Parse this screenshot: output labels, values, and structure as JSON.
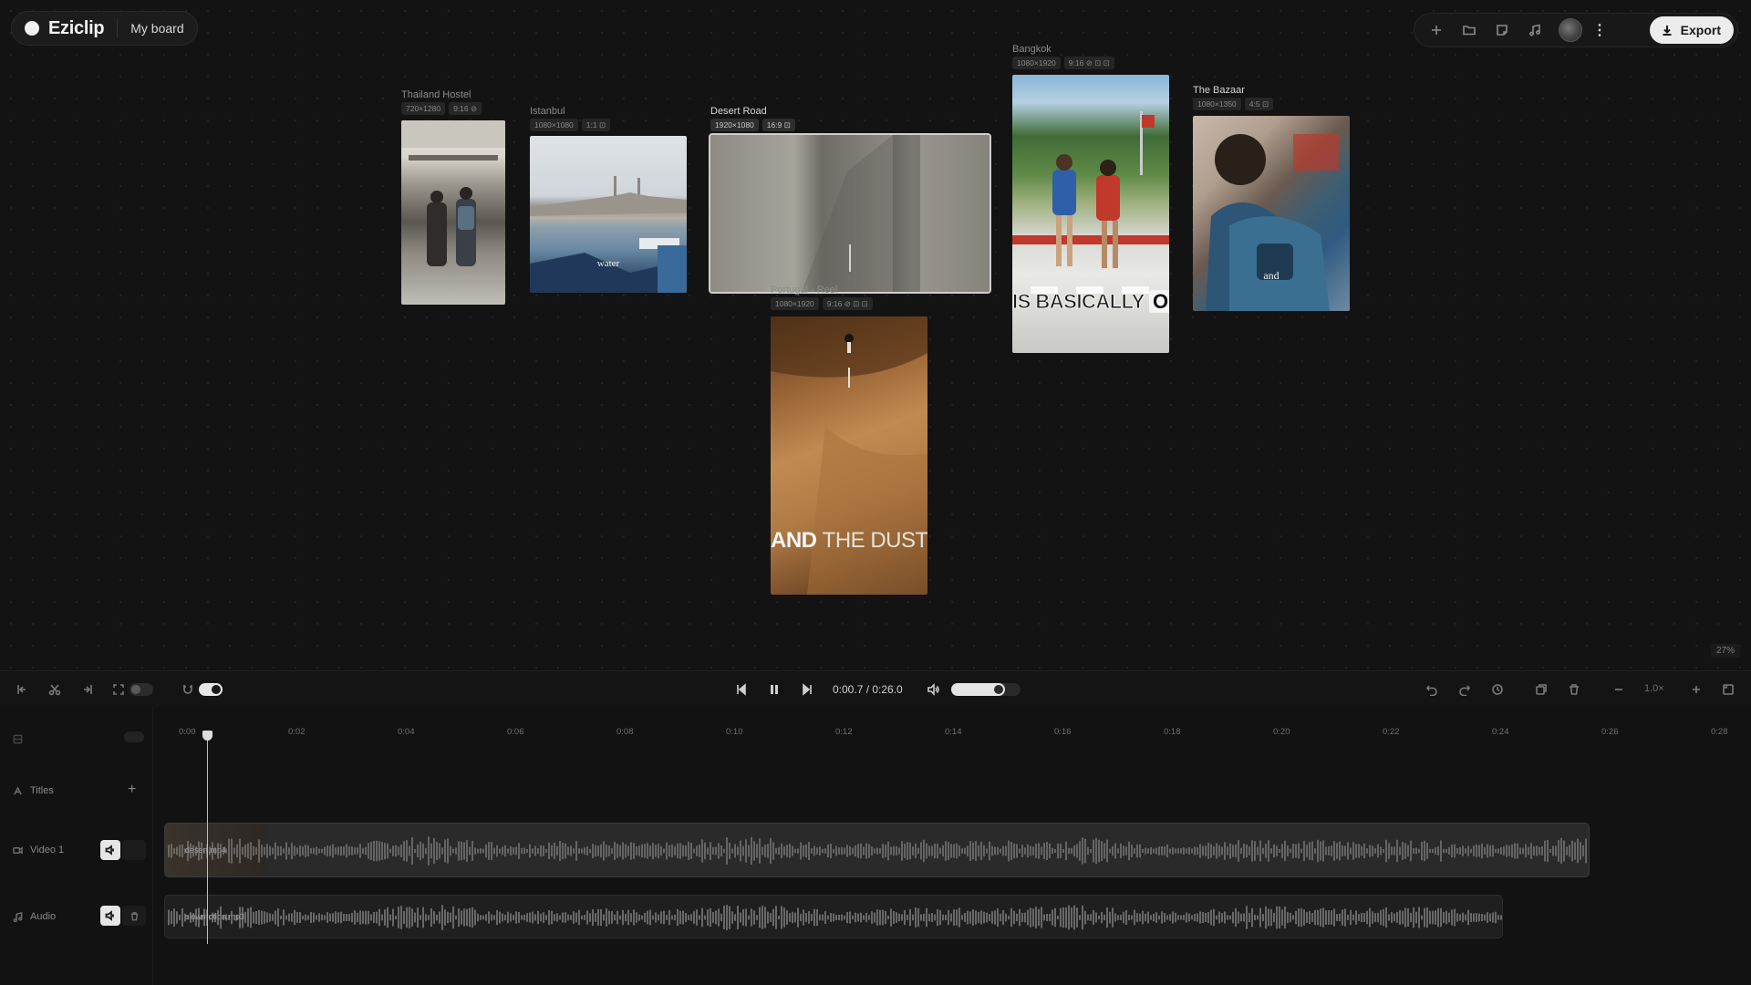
{
  "app": {
    "name": "Eziclip",
    "board": "My board"
  },
  "toolbar": {
    "export_label": "Export",
    "more_label": "⋮"
  },
  "clips": [
    {
      "id": "hostel",
      "title": "Thailand Hostel",
      "meta": [
        "720×1280",
        "9:16 ⊘"
      ],
      "caption": ""
    },
    {
      "id": "istanbul",
      "title": "Istanbul",
      "meta": [
        "1080×1080",
        "1:1 ⊡"
      ],
      "caption": "water"
    },
    {
      "id": "desert",
      "title": "Desert Road",
      "meta": [
        "1920×1080",
        "16:9 ⊡"
      ],
      "caption": ""
    },
    {
      "id": "bangkok",
      "title": "Bangkok",
      "meta": [
        "1080×1920",
        "9:16 ⊘ ⊡ ⊡"
      ],
      "caption_a": "IS BASICALLY",
      "caption_b": "ON"
    },
    {
      "id": "bazaar",
      "title": "The Bazaar",
      "meta": [
        "1080×1350",
        "4:5 ⊡"
      ],
      "caption": "and"
    },
    {
      "id": "portugal",
      "title": "Portugal - Reel",
      "meta": [
        "1080×1920",
        "9:16 ⊘ ⊡ ⊡"
      ],
      "caption_a": "AND",
      "caption_b": "THE DUST"
    }
  ],
  "canvas_zoom": "27%",
  "playback": {
    "time": "0:00.7 / 0:26.0",
    "volume": 0.78
  },
  "zoom_value": "1.0×",
  "timeline": {
    "ticks": [
      "0:00",
      "0:02",
      "0:04",
      "0:06",
      "0:08",
      "0:10",
      "0:12",
      "0:14",
      "0:16",
      "0:18",
      "0:20",
      "0:22",
      "0:24",
      "0:26",
      "0:28"
    ],
    "tracks": {
      "titles": "Titles",
      "video": "Video 1",
      "audio": "Audio"
    },
    "video_clip": "desert.mp4",
    "audio_clip": "slowmotion.mp3",
    "add_label": "+"
  }
}
